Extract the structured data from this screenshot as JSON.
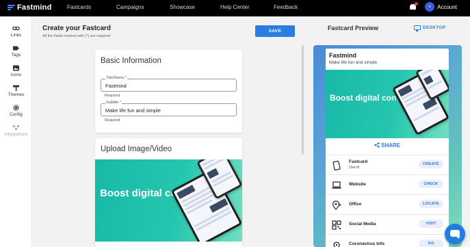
{
  "app": {
    "brand": "Fastmind"
  },
  "nav": {
    "items": [
      "Fastcards",
      "Campaigns",
      "Showcase",
      "Help Center",
      "Feedback"
    ],
    "account_label": "Account",
    "avatar_initial": "v"
  },
  "sidebar": {
    "items": [
      {
        "label": "Links",
        "icon": "link-icon"
      },
      {
        "label": "Tags",
        "icon": "tag-icon"
      },
      {
        "label": "Icons",
        "icon": "image-icon"
      },
      {
        "label": "Themes",
        "icon": "paint-roller-icon"
      },
      {
        "label": "Config",
        "icon": "gear-icon"
      },
      {
        "label": "Integrations",
        "icon": "integrations-icon"
      }
    ]
  },
  "editor": {
    "title": "Create your Fastcard",
    "subtitle": "All the fields marked with (*) are required",
    "save_label": "SAVE",
    "basic": {
      "title": "Basic Information",
      "name_label": "Title/Name *",
      "name_value": "Fastmind",
      "name_helper": "Required",
      "subtitle_label": "Subtitle *",
      "subtitle_value": "Make life fun and simple",
      "subtitle_helper": "Required"
    },
    "upload": {
      "title": "Upload Image/Video",
      "promo_text": "Boost digital conversion"
    }
  },
  "preview": {
    "title": "Fastcard Preview",
    "mode_label": "DESKTOP",
    "card_title": "Fastmind",
    "card_subtitle": "Make life fun and simple",
    "promo_text": "Boost digital conversion",
    "share_label": "SHARE",
    "rows": [
      {
        "label": "Fastcard",
        "sublabel": "Use it!",
        "button": "CREATE",
        "icon": "phone-icon"
      },
      {
        "label": "Website",
        "sublabel": "",
        "button": "CHECK",
        "icon": "laptop-icon"
      },
      {
        "label": "Office",
        "sublabel": "",
        "button": "LOCATE",
        "icon": "location-pin-icon"
      },
      {
        "label": "Social Media",
        "sublabel": "",
        "button": "VISIT",
        "icon": "qr-code-icon"
      },
      {
        "label": "Coronavirus Info",
        "sublabel": "",
        "button": "GO",
        "icon": "virus-icon"
      }
    ]
  },
  "colors": {
    "accent": "#2a7de1",
    "topbar": "#000000",
    "promo_teal": "#25c5ae"
  }
}
